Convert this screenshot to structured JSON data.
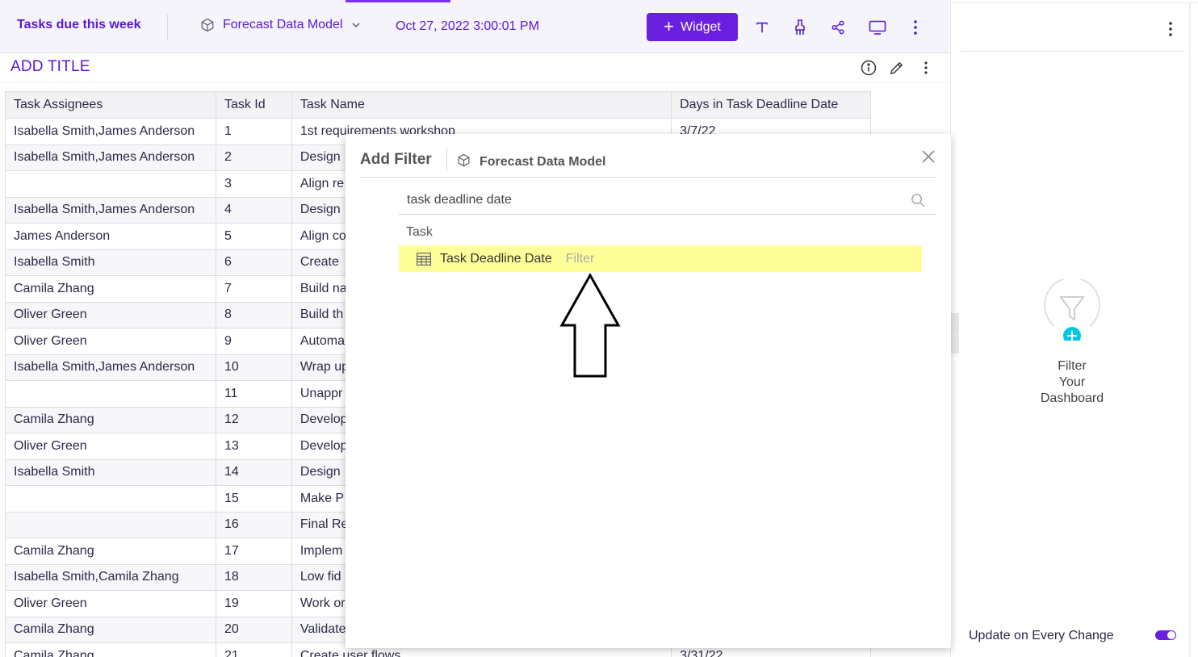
{
  "toolbar": {
    "dashboard_title": "Tasks due this week",
    "model_name": "Forecast Data Model",
    "timestamp": "Oct 27, 2022 3:00:01 PM",
    "widget_label": "Widget"
  },
  "widget": {
    "title": "ADD TITLE"
  },
  "table": {
    "headers": [
      "Task Assignees",
      "Task Id",
      "Task Name",
      "Days in Task Deadline Date"
    ],
    "rows": [
      [
        "Isabella Smith,James Anderson",
        "1",
        "1st requirements workshop",
        "3/7/22"
      ],
      [
        "Isabella Smith,James Anderson",
        "2",
        "Design",
        ""
      ],
      [
        "",
        "3",
        "Align re",
        ""
      ],
      [
        "Isabella Smith,James Anderson",
        "4",
        "Design",
        ""
      ],
      [
        "James Anderson",
        "5",
        "Align co",
        ""
      ],
      [
        "Isabella Smith",
        "6",
        "Create",
        ""
      ],
      [
        "Camila Zhang",
        "7",
        "Build na",
        ""
      ],
      [
        "Oliver Green",
        "8",
        "Build th",
        ""
      ],
      [
        "Oliver Green",
        "9",
        "Automa",
        ""
      ],
      [
        "Isabella Smith,James Anderson",
        "10",
        "Wrap up",
        ""
      ],
      [
        "",
        "11",
        "Unappr",
        ""
      ],
      [
        "Camila Zhang",
        "12",
        "Develop",
        ""
      ],
      [
        "Oliver Green",
        "13",
        "Develop",
        ""
      ],
      [
        "Isabella Smith",
        "14",
        "Design",
        ""
      ],
      [
        "",
        "15",
        "Make P",
        ""
      ],
      [
        "",
        "16",
        "Final Re",
        ""
      ],
      [
        "Camila Zhang",
        "17",
        "Implem",
        ""
      ],
      [
        "Isabella Smith,Camila Zhang",
        "18",
        "Low fid",
        ""
      ],
      [
        "Oliver Green",
        "19",
        "Work or",
        ""
      ],
      [
        "Camila Zhang",
        "20",
        "Validate",
        ""
      ],
      [
        "Camila Zhang",
        "21",
        "Create user flows",
        "3/31/22"
      ]
    ]
  },
  "modal": {
    "title": "Add Filter",
    "model_name": "Forecast Data Model",
    "search_value": "task deadline date",
    "group_label": "Task",
    "result_name": "Task Deadline Date",
    "result_tag": "Filter"
  },
  "right_panel": {
    "filter_text": [
      "Filter",
      "Your",
      "Dashboard"
    ],
    "update_label": "Update on Every Change",
    "toggle_on": true
  },
  "colors": {
    "accent": "#6a1fe0",
    "highlight": "#ffff99",
    "filter_plus": "#00c8e6"
  }
}
